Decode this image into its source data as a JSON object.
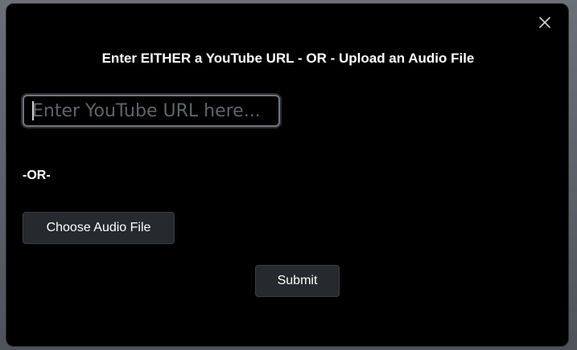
{
  "modal": {
    "title": "Enter EITHER a YouTube URL - OR - Upload an Audio File",
    "close_icon": "close-icon",
    "url_input": {
      "value": "",
      "placeholder": "Enter YouTube URL here..."
    },
    "or_label": "-OR-",
    "choose_file_label": "Choose Audio File",
    "submit_label": "Submit"
  },
  "colors": {
    "modal_background": "#000000",
    "button_background": "#26292d",
    "input_border": "#6f757c",
    "text": "#ffffff"
  }
}
